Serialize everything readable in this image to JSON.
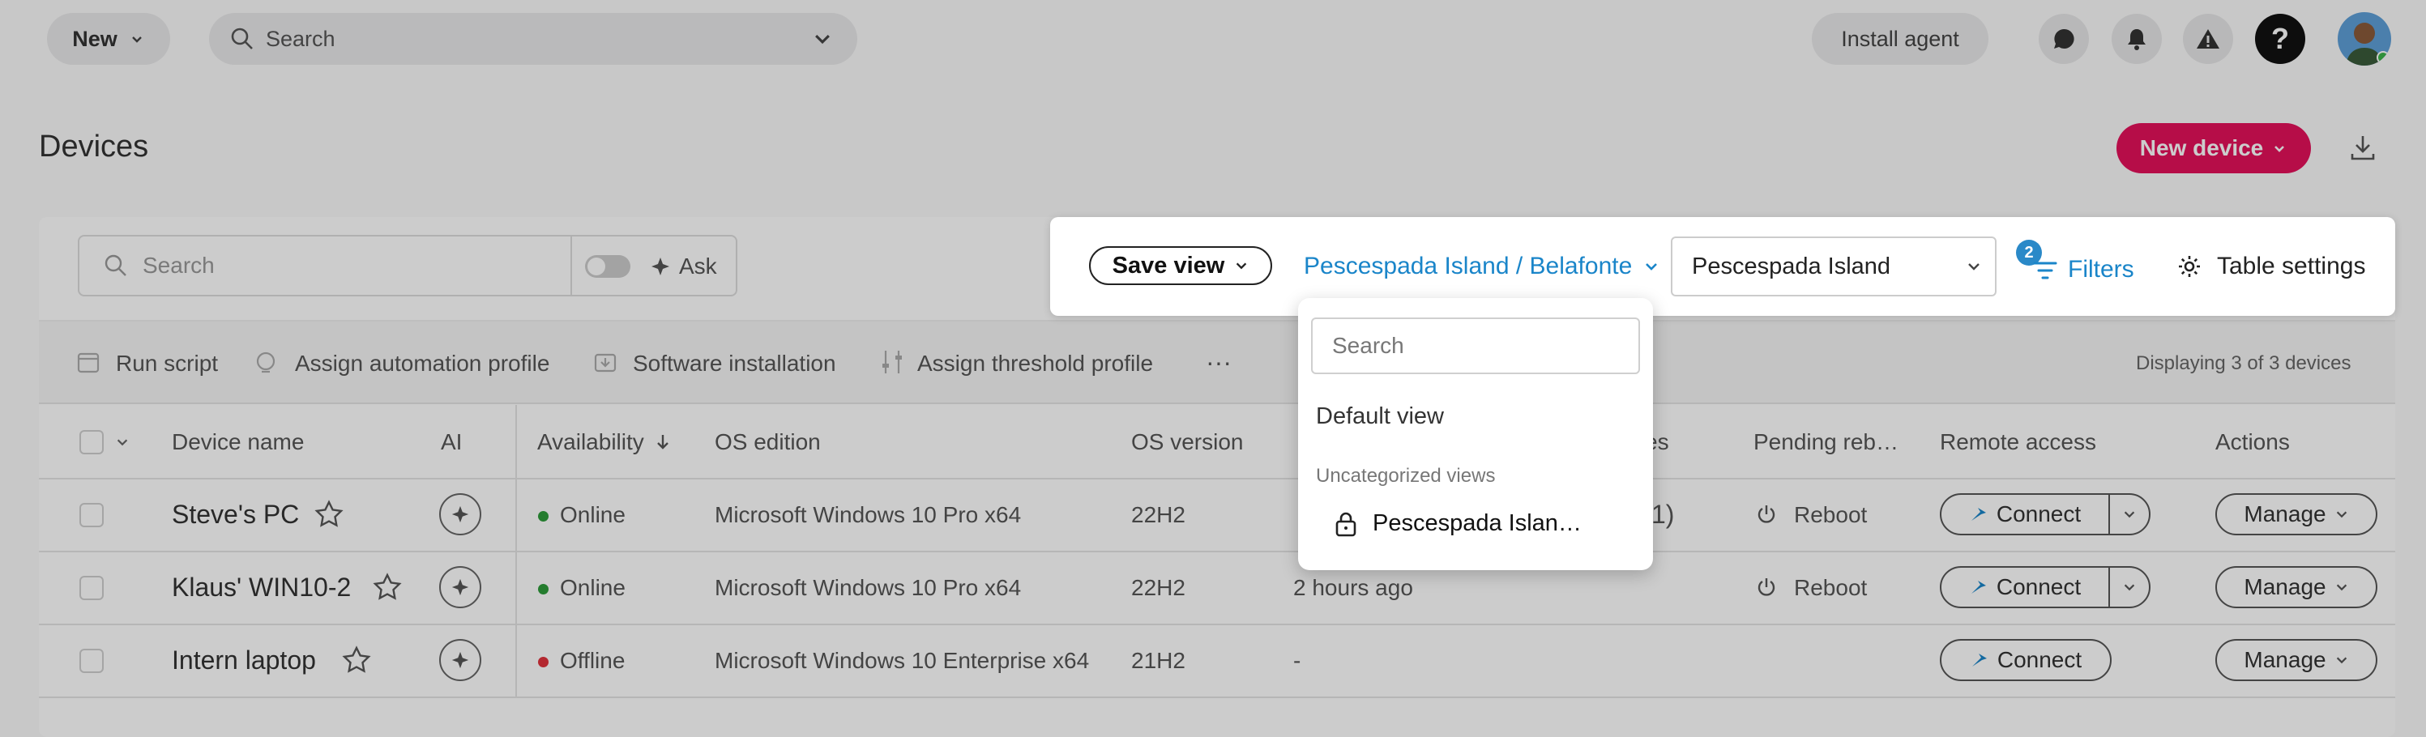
{
  "colors": {
    "accent": "#1a85c9",
    "brand": "#e4115a",
    "online": "#2e9b3a",
    "offline": "#e0323c",
    "badge": "#2a89c8"
  },
  "topbar": {
    "new_label": "New",
    "search_placeholder": "Search",
    "install_agent_label": "Install agent",
    "help_glyph": "?"
  },
  "page": {
    "title": "Devices",
    "new_device_label": "New device"
  },
  "toolbar": {
    "search_placeholder": "Search",
    "ask_label": "Ask",
    "actions": [
      "Run script",
      "Assign automation profile",
      "Software installation",
      "Assign threshold profile"
    ],
    "more_label": "···",
    "display_count": "Displaying 3 of 3 devices"
  },
  "table": {
    "headers": {
      "device_name": "Device name",
      "ai": "AI",
      "availability": "Availability",
      "os_edition": "OS edition",
      "os_version": "OS version",
      "patches_partial": "es",
      "pending_reboot": "Pending reb…",
      "remote_access": "Remote access",
      "actions": "Actions"
    },
    "rows": [
      {
        "name": "Steve's PC",
        "availability": "Online",
        "os_edition": "Microsoft Windows 10 Pro x64",
        "os_version": "22H2",
        "last_seen": "",
        "patches": "1)",
        "reboot": "Reboot",
        "connect": "Connect",
        "manage": "Manage"
      },
      {
        "name": "Klaus' WIN10-2",
        "availability": "Online",
        "os_edition": "Microsoft Windows 10 Pro x64",
        "os_version": "22H2",
        "last_seen": "2 hours ago",
        "patches": "",
        "reboot": "Reboot",
        "connect": "Connect",
        "manage": "Manage"
      },
      {
        "name": "Intern laptop",
        "availability": "Offline",
        "os_edition": "Microsoft Windows 10 Enterprise x64",
        "os_version": "21H2",
        "last_seen": "-",
        "patches": "",
        "reboot": "",
        "connect": "Connect",
        "manage": "Manage"
      }
    ]
  },
  "viewbar": {
    "save_view_label": "Save view",
    "current_view": "Pescespada Island / Belafonte",
    "site_select_value": "Pescespada Island",
    "filters_label": "Filters",
    "filters_count": "2",
    "table_settings_label": "Table settings"
  },
  "views_dropdown": {
    "search_placeholder": "Search",
    "default_view": "Default view",
    "group_label": "Uncategorized views",
    "items": [
      {
        "label": "Pescespada Islan…"
      }
    ]
  }
}
